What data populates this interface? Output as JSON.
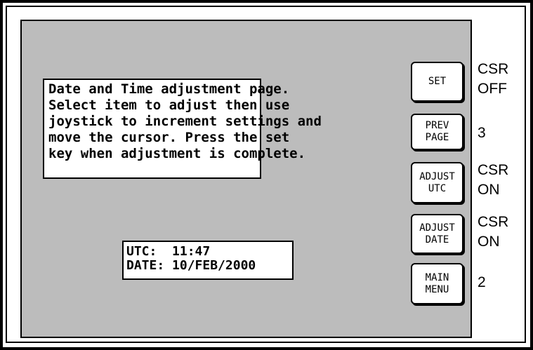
{
  "info_lines": [
    "Date and Time adjustment page.",
    "Select item to adjust then use",
    "joystick to increment settings and",
    "move the cursor. Press the set",
    "key when adjustment is complete."
  ],
  "clock": {
    "utc_label": "UTC:",
    "utc_value": "11:47",
    "date_label": "DATE:",
    "date_value": "10/FEB/2000"
  },
  "buttons": [
    {
      "lines": [
        "SET"
      ],
      "status": [
        "CSR",
        "OFF"
      ]
    },
    {
      "lines": [
        "PREV",
        "PAGE"
      ],
      "status": [
        "3"
      ]
    },
    {
      "lines": [
        "ADJUST",
        "UTC"
      ],
      "status": [
        "CSR",
        "ON"
      ]
    },
    {
      "lines": [
        "ADJUST",
        "DATE"
      ],
      "status": [
        "CSR",
        "ON"
      ]
    },
    {
      "lines": [
        "MAIN",
        "MENU"
      ],
      "status": [
        "2"
      ]
    }
  ],
  "colors": {
    "screen_bg": "#bcbcbc",
    "panel_bg": "#ffffff",
    "ink": "#000000"
  }
}
